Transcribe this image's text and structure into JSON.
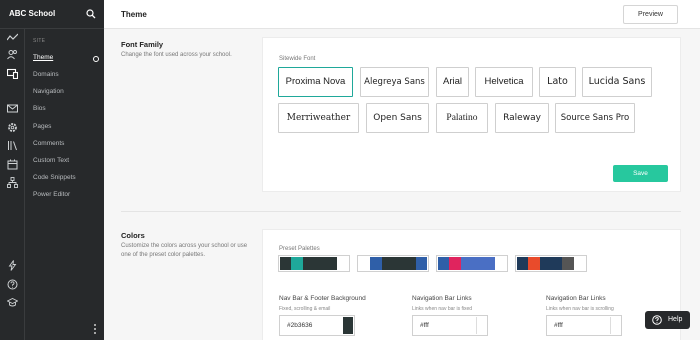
{
  "app": {
    "school_name": "ABC School"
  },
  "header": {
    "title": "Theme",
    "preview_label": "Preview"
  },
  "sidebar": {
    "section_label": "SITE",
    "items": [
      {
        "label": "Theme",
        "active": true
      },
      {
        "label": "Domains"
      },
      {
        "label": "Navigation"
      },
      {
        "label": "Bios"
      },
      {
        "label": "Pages"
      },
      {
        "label": "Comments"
      },
      {
        "label": "Custom Text"
      },
      {
        "label": "Code Snippets"
      },
      {
        "label": "Power Editor"
      }
    ],
    "rail_icons": [
      "analytics-icon",
      "users-icon",
      "site-icon",
      "mail-icon",
      "settings-icon",
      "library-icon",
      "calendar-icon",
      "sitemap-icon",
      "lightning-icon",
      "help-circle-icon",
      "graduation-cap-icon"
    ]
  },
  "font_family": {
    "title": "Font Family",
    "description": "Change the font used across your school.",
    "field_label": "Sitewide Font",
    "options": [
      {
        "label": "Proxima Nova",
        "selected": true
      },
      {
        "label": "Alegreya Sans"
      },
      {
        "label": "Arial"
      },
      {
        "label": "Helvetica"
      },
      {
        "label": "Lato"
      },
      {
        "label": "Lucida Sans"
      },
      {
        "label": "Merriweather"
      },
      {
        "label": "Open Sans"
      },
      {
        "label": "Palatino"
      },
      {
        "label": "Raleway"
      },
      {
        "label": "Source Sans Pro"
      }
    ],
    "save_label": "Save"
  },
  "colors": {
    "title": "Colors",
    "description": "Customize the colors across your school or use one of the preset color palettes.",
    "preset_label": "Preset Palettes",
    "palettes": [
      [
        "#2b3636",
        "#1fa89a",
        "#2b3636",
        "#2b3636",
        "#ffffff"
      ],
      [
        "#ffffff",
        "#2f5fa8",
        "#2b3636",
        "#2b3636",
        "#2f5fa8"
      ],
      [
        "#2f5fa8",
        "#e0245e",
        "#4a6fc4",
        "#4a6fc4",
        "#ffffff"
      ],
      [
        "#1f3a5a",
        "#e94b2b",
        "#1f3a5a",
        "#555555",
        "#ffffff"
      ]
    ],
    "fields": [
      {
        "label": "Nav Bar & Footer Background",
        "sub": "Fixed, scrolling & email",
        "value": "#2b3636",
        "chip": "#2b3636"
      },
      {
        "label": "Navigation Bar Links",
        "sub": "Links when nav bar is fixed",
        "value": "#fff",
        "chip": "#ffffff"
      },
      {
        "label": "Navigation Bar Links",
        "sub": "Links when nav bar is scrolling",
        "value": "#fff",
        "chip": "#ffffff"
      }
    ]
  },
  "help": {
    "label": "Help"
  },
  "colors_theme": {
    "sidebar_bg": "#27292b",
    "accent": "#1fa89a",
    "save_green": "#27c89e"
  }
}
